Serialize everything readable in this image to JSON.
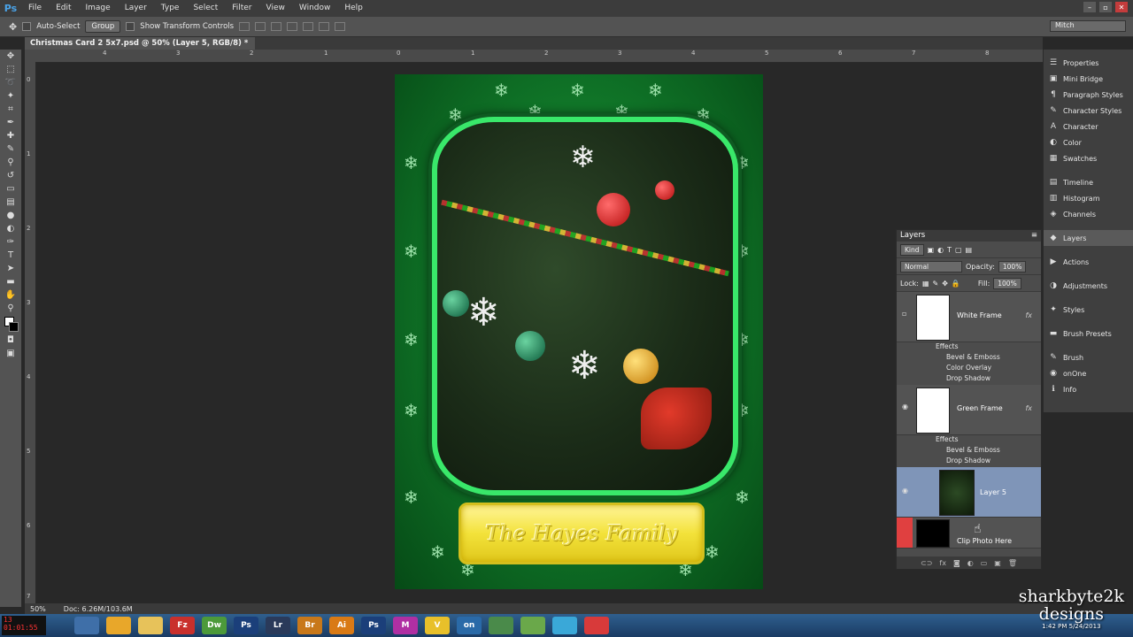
{
  "app": {
    "logo": "Ps",
    "menu": [
      "File",
      "Edit",
      "Image",
      "Layer",
      "Type",
      "Select",
      "Filter",
      "View",
      "Window",
      "Help"
    ],
    "window_controls": [
      "–",
      "▫",
      "✕"
    ]
  },
  "options_bar": {
    "auto_select_label": "Auto-Select",
    "auto_select_value": "Group",
    "transform_label": "Show Transform Controls",
    "workspace": "Mitch"
  },
  "document_tab": {
    "title": "Christmas Card 2 5x7.psd @ 50% (Layer 5, RGB/8) *"
  },
  "rulers": {
    "top": [
      "4",
      "3",
      "2",
      "1",
      "0",
      "1",
      "2",
      "3",
      "4",
      "5",
      "6",
      "7",
      "8",
      "9"
    ],
    "left": [
      "0",
      "1",
      "2",
      "3",
      "4",
      "5",
      "6",
      "7"
    ]
  },
  "card": {
    "name_text": "The Hayes Family",
    "background_color": "#117a2a",
    "frame_color": "#39e86a",
    "plate_color": "#f3e23a"
  },
  "dock": {
    "items": [
      {
        "label": "Properties",
        "icon": "properties-icon",
        "glyph": "☰"
      },
      {
        "label": "Mini Bridge",
        "icon": "mini-bridge-icon",
        "glyph": "▣"
      },
      {
        "label": "Paragraph Styles",
        "icon": "paragraph-styles-icon",
        "glyph": "¶"
      },
      {
        "label": "Character Styles",
        "icon": "character-styles-icon",
        "glyph": "✎"
      },
      {
        "label": "Character",
        "icon": "character-icon",
        "glyph": "A"
      },
      {
        "label": "Color",
        "icon": "color-icon",
        "glyph": "◐"
      },
      {
        "label": "Swatches",
        "icon": "swatches-icon",
        "glyph": "▦"
      },
      {
        "label": "Timeline",
        "icon": "timeline-icon",
        "glyph": "▤"
      },
      {
        "label": "Histogram",
        "icon": "histogram-icon",
        "glyph": "▥"
      },
      {
        "label": "Channels",
        "icon": "channels-icon",
        "glyph": "◈"
      },
      {
        "label": "Layers",
        "icon": "layers-icon",
        "glyph": "◆"
      },
      {
        "label": "Actions",
        "icon": "actions-icon",
        "glyph": "▶"
      },
      {
        "label": "Adjustments",
        "icon": "adjustments-icon",
        "glyph": "◑"
      },
      {
        "label": "Styles",
        "icon": "styles-icon",
        "glyph": "✦"
      },
      {
        "label": "Brush Presets",
        "icon": "brush-presets-icon",
        "glyph": "▬"
      },
      {
        "label": "Brush",
        "icon": "brush-icon",
        "glyph": "✎"
      },
      {
        "label": "onOne",
        "icon": "onone-icon",
        "glyph": "◉"
      },
      {
        "label": "Info",
        "icon": "info-icon",
        "glyph": "ℹ"
      }
    ]
  },
  "layers_panel": {
    "title": "Layers",
    "filter": "Kind",
    "blend_mode": "Normal",
    "opacity_label": "Opacity:",
    "opacity": "100%",
    "lock_label": "Lock:",
    "fill_label": "Fill:",
    "fill": "100%",
    "effects_label": "Effects",
    "layers": [
      {
        "name": "White Frame",
        "effects": [
          "Bevel & Emboss",
          "Color Overlay",
          "Drop Shadow"
        ]
      },
      {
        "name": "Green Frame",
        "effects": [
          "Bevel & Emboss",
          "Drop Shadow"
        ]
      },
      {
        "name": "Layer 5",
        "effects": []
      },
      {
        "name": "Clip Photo Here",
        "effects": []
      }
    ]
  },
  "status_bar": {
    "zoom": "50%",
    "doc_size": "Doc: 6.26M/103.6M"
  },
  "taskbar": {
    "clock": "13  01:01:55",
    "apps": [
      "",
      "",
      "",
      "Fz",
      "Dw",
      "Ps",
      "Lr",
      "Br",
      "Ai",
      "Ps",
      "M",
      "V",
      "on",
      "",
      "",
      "",
      ""
    ],
    "app_colors": [
      "#3f6fa8",
      "#e8a72a",
      "#e7c25a",
      "#c9302c",
      "#4c9a3a",
      "#1b3f7a",
      "#2a3a5a",
      "#c8781a",
      "#d97a15",
      "#1b3f7a",
      "#b02fa3",
      "#e8c02a",
      "#2a6aa8",
      "#4a8a4a",
      "#6aa84a",
      "#3aa8d8",
      "#d83a3a"
    ]
  },
  "watermark": {
    "line1": "sharkbyte2k",
    "line2": "designs",
    "time": "1:42 PM",
    "date": "5/24/2013"
  }
}
